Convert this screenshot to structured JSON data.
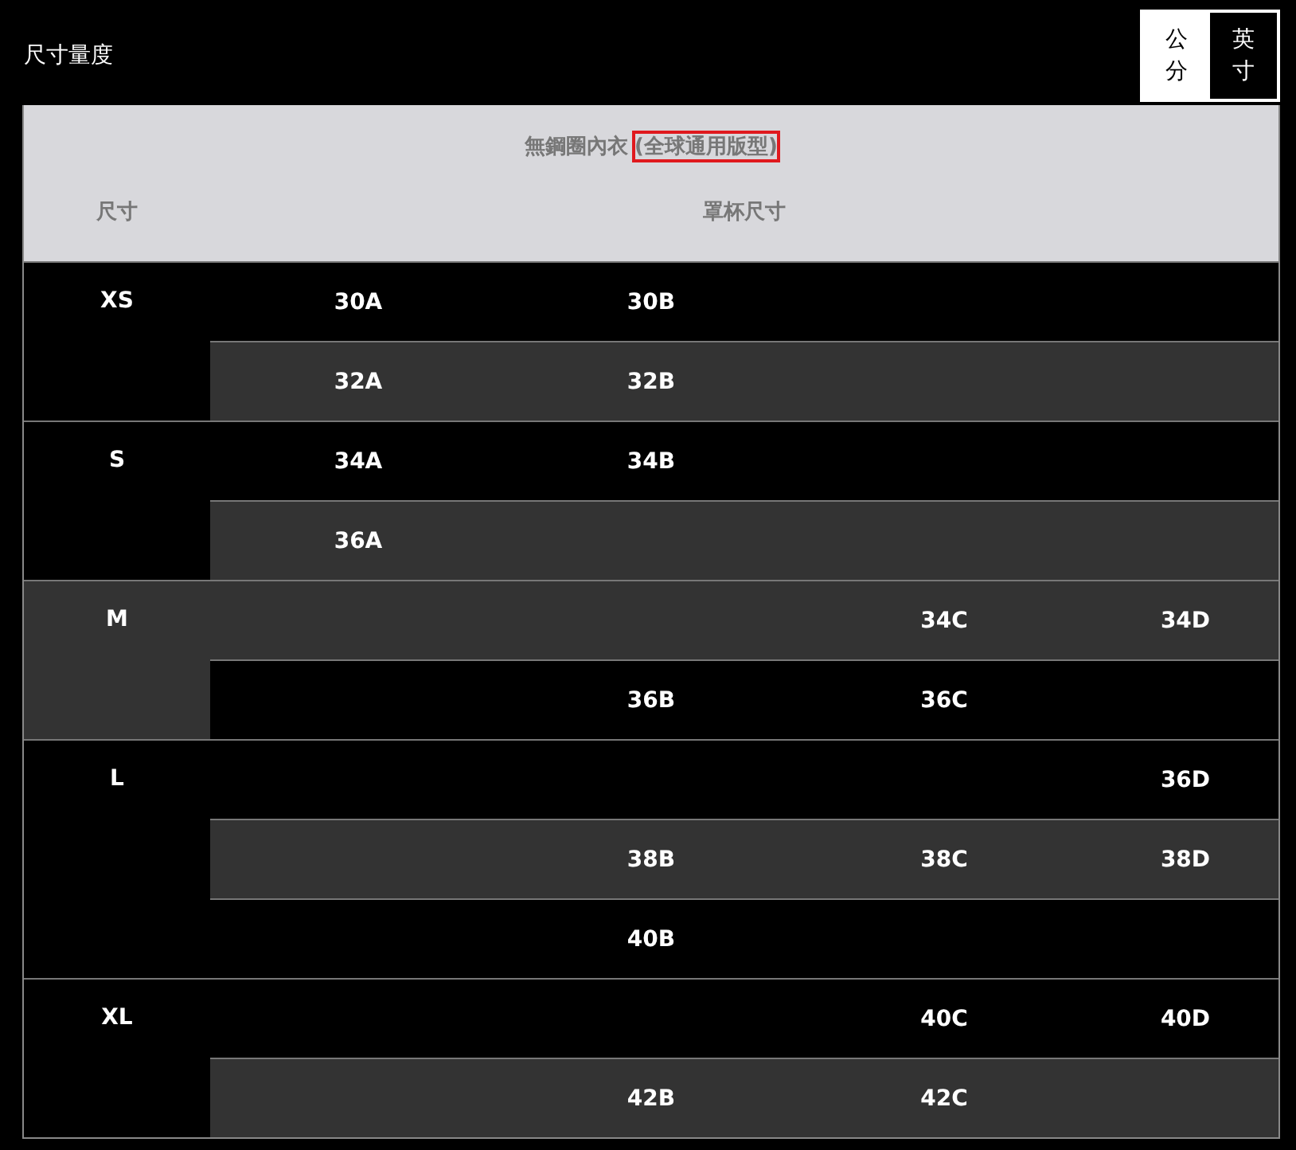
{
  "title": "尺寸量度",
  "unit_toggle": [
    {
      "label": "公分",
      "selected": false
    },
    {
      "label": "英寸",
      "selected": true
    }
  ],
  "table": {
    "caption": [
      {
        "text": "無鋼圈內衣",
        "highlighted": false
      },
      {
        "text": "(全球通用版型)",
        "highlighted": true
      }
    ],
    "columns": [
      "尺寸",
      "罩杯尺寸"
    ],
    "groups": [
      {
        "size": "XS",
        "shaded": false,
        "rows": [
          {
            "shaded": false,
            "cells": [
              "30A",
              "30B",
              null,
              null
            ]
          },
          {
            "shaded": true,
            "cells": [
              "32A",
              "32B",
              null,
              null
            ]
          }
        ]
      },
      {
        "size": "S",
        "shaded": false,
        "rows": [
          {
            "shaded": false,
            "cells": [
              "34A",
              "34B",
              null,
              null
            ]
          },
          {
            "shaded": true,
            "cells": [
              "36A",
              null,
              null,
              null
            ]
          }
        ]
      },
      {
        "size": "M",
        "shaded": true,
        "rows": [
          {
            "shaded": true,
            "cells": [
              null,
              null,
              "34C",
              "34D"
            ]
          },
          {
            "shaded": false,
            "cells": [
              null,
              "36B",
              "36C",
              null
            ]
          }
        ]
      },
      {
        "size": "L",
        "shaded": false,
        "rows": [
          {
            "shaded": false,
            "cells": [
              null,
              null,
              null,
              "36D"
            ]
          },
          {
            "shaded": true,
            "cells": [
              null,
              "38B",
              "38C",
              "38D"
            ]
          },
          {
            "shaded": false,
            "cells": [
              null,
              "40B",
              null,
              null
            ]
          }
        ]
      },
      {
        "size": "XL",
        "shaded": false,
        "rows": [
          {
            "shaded": false,
            "cells": [
              null,
              null,
              "40C",
              "40D"
            ]
          },
          {
            "shaded": true,
            "cells": [
              null,
              "42B",
              "42C",
              null
            ]
          }
        ]
      }
    ]
  }
}
